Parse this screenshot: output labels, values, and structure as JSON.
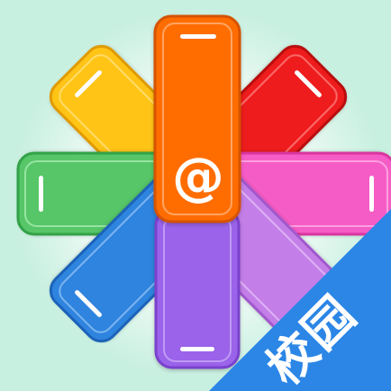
{
  "app_icon": {
    "center_glyph": "@",
    "badge_text": "校园",
    "icon_names": [
      "at-sign-icon",
      "color-swatch-fan-icon"
    ]
  },
  "colors": {
    "background": "#c8f0e0",
    "glow": "#ffffff",
    "badge": "#2b86e6",
    "swatches": {
      "yellow": "#ffc414",
      "red": "#ee1c1c",
      "pink": "#f65bc6",
      "green": "#56c667",
      "blue": "#2f84de",
      "light_purple": "#c47ee8",
      "purple": "#9a63ea",
      "orange": "#ff6d00"
    }
  }
}
